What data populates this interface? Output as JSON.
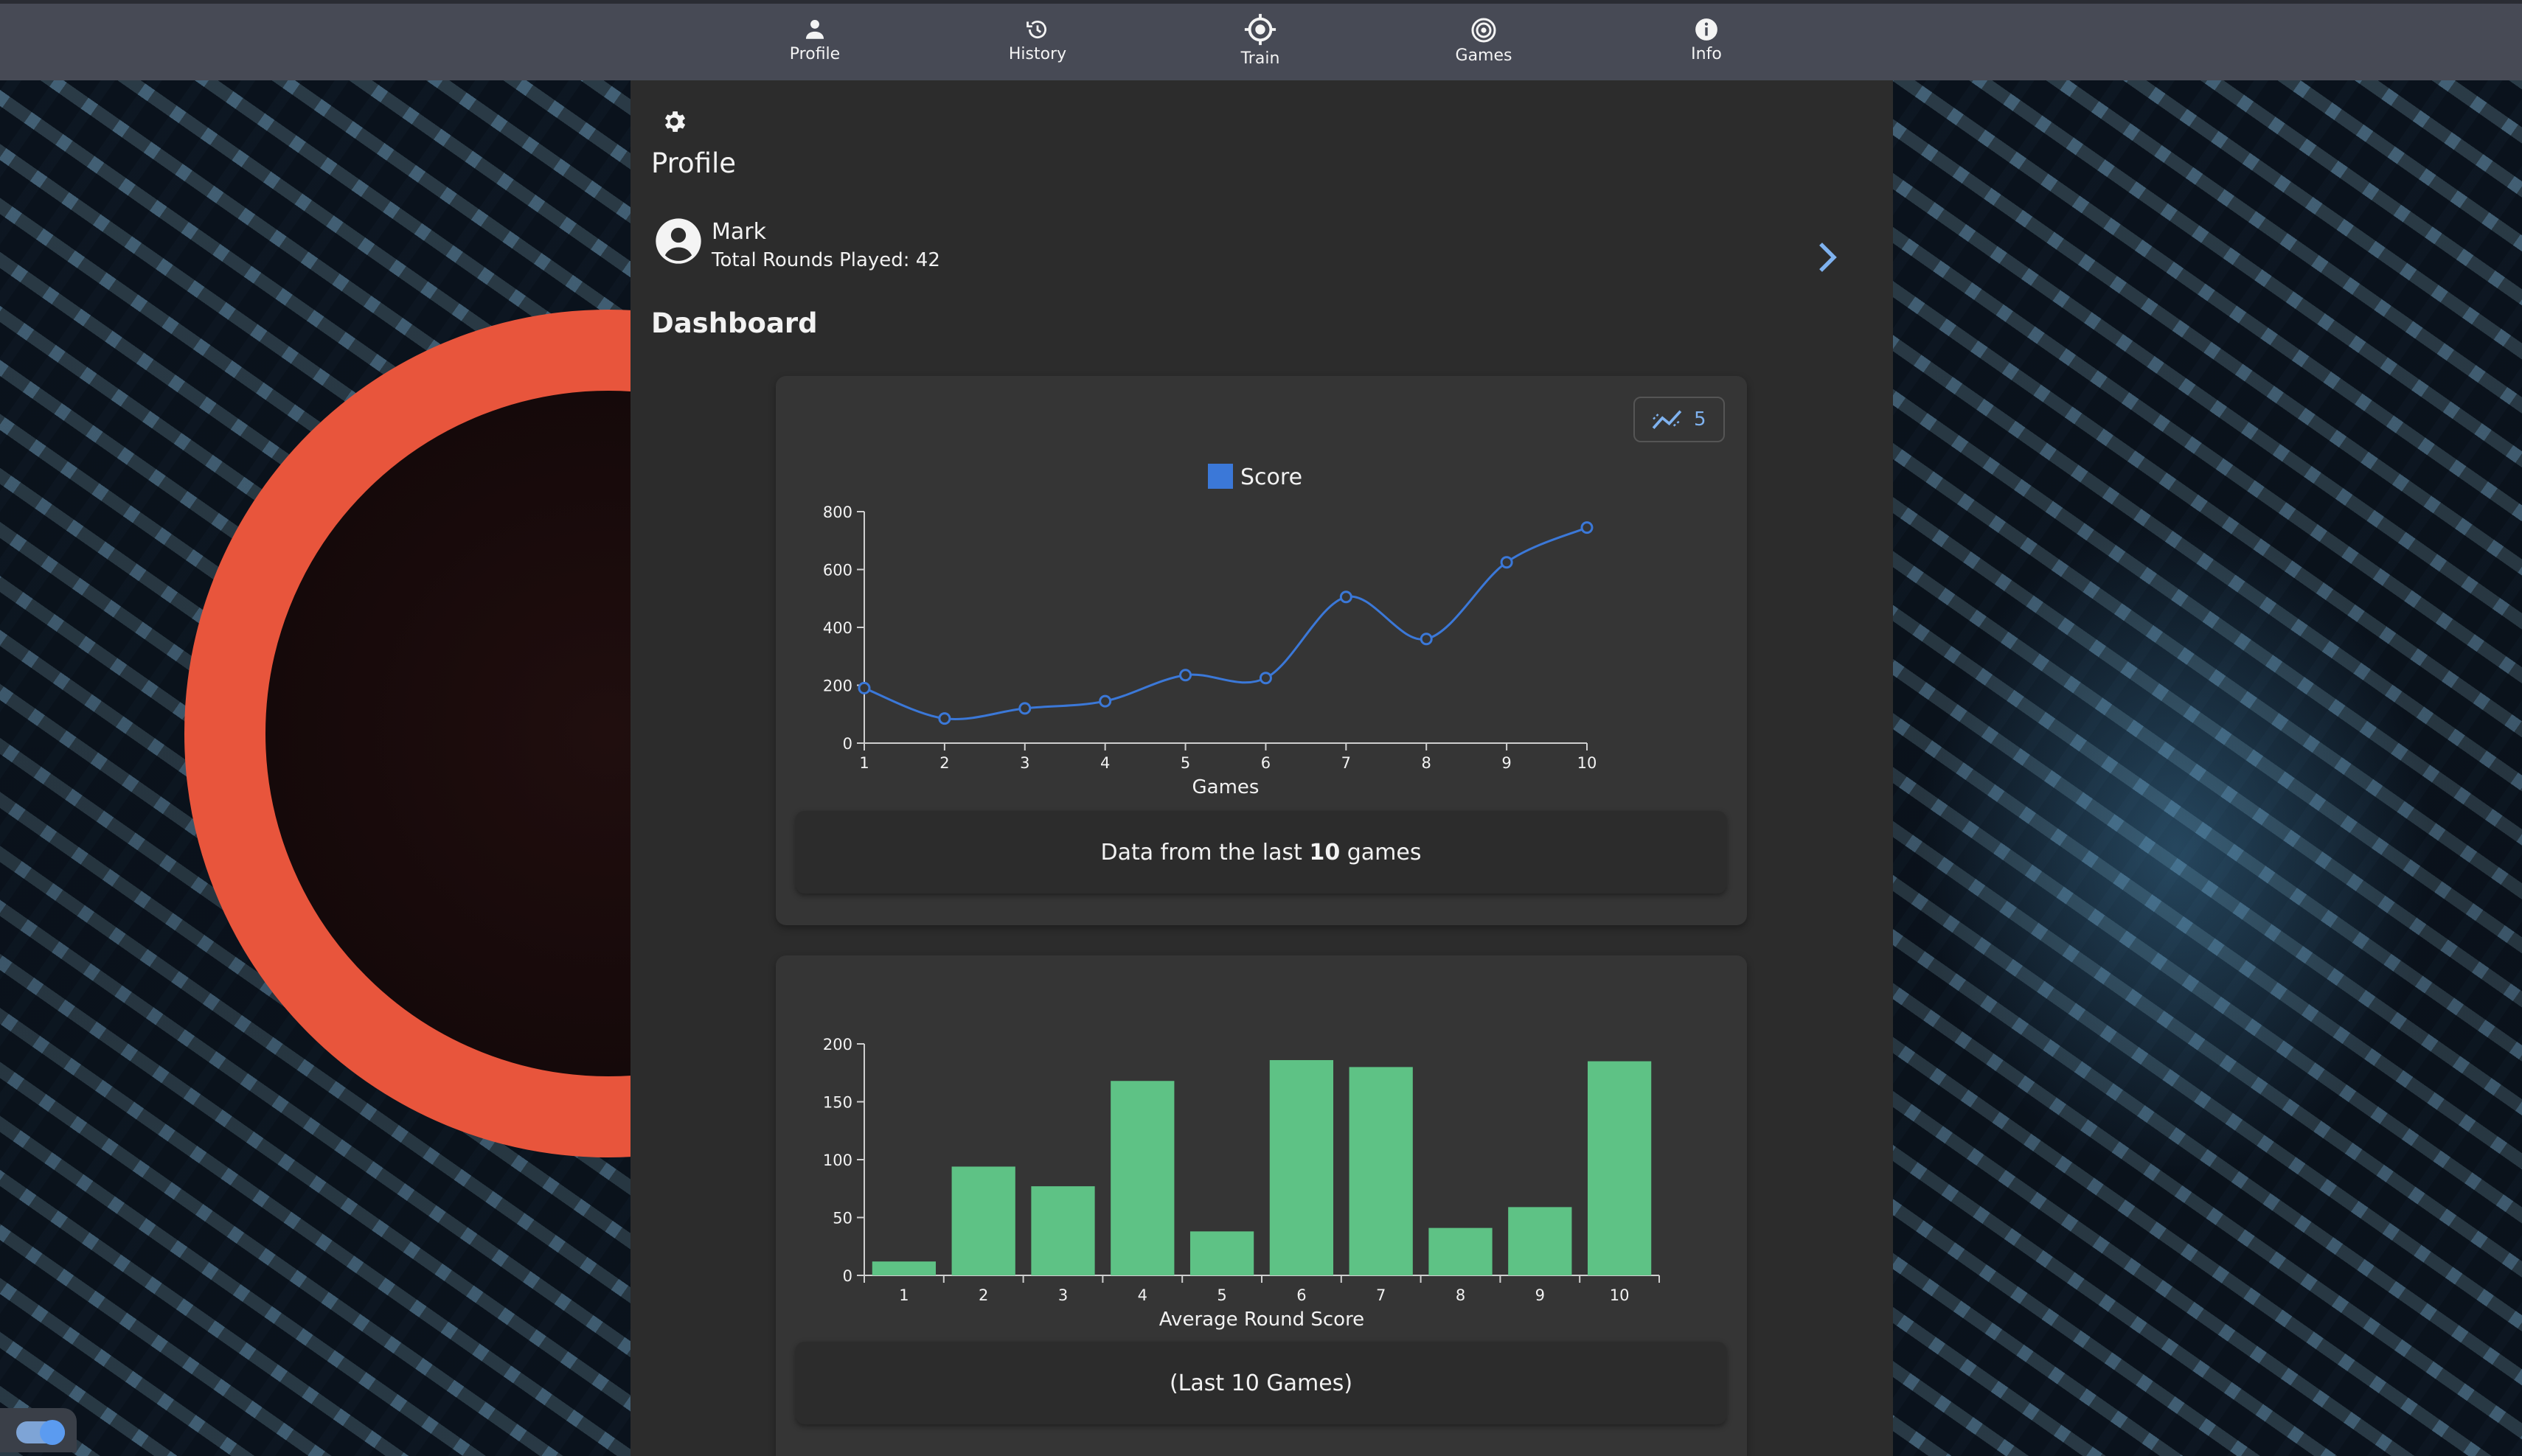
{
  "nav": {
    "items": [
      {
        "label": "Profile",
        "icon": "person-icon"
      },
      {
        "label": "History",
        "icon": "history-icon"
      },
      {
        "label": "Train",
        "icon": "crosshair-icon"
      },
      {
        "label": "Games",
        "icon": "target-icon"
      },
      {
        "label": "Info",
        "icon": "info-icon"
      }
    ]
  },
  "page": {
    "title": "Profile",
    "dashboard_title": "Dashboard"
  },
  "profile": {
    "name": "Mark",
    "rounds_text": "Total Rounds Played: 42"
  },
  "trend_button": {
    "value": "5"
  },
  "captions": {
    "score_prefix": "Data from the last ",
    "score_count": "10",
    "score_suffix": " games",
    "avg": "(Last 10 Games)"
  },
  "colors": {
    "accent": "#3b78d8",
    "bar": "#5ec285",
    "highlight": "#e8553c"
  },
  "chart_data": [
    {
      "type": "line",
      "legend": [
        "Score"
      ],
      "legend_placement": "top-center",
      "xlabel": "Games",
      "ylabel": "",
      "x": [
        1,
        2,
        3,
        4,
        5,
        6,
        7,
        8,
        9,
        10
      ],
      "xticks": [
        "1",
        "2",
        "3",
        "4",
        "5",
        "6",
        "7",
        "8",
        "9",
        "10"
      ],
      "yticks": [
        "0",
        "200",
        "400",
        "600",
        "800"
      ],
      "ylim": [
        0,
        800
      ],
      "series": [
        {
          "name": "Score",
          "values": [
            190,
            85,
            120,
            145,
            235,
            225,
            505,
            360,
            625,
            745
          ]
        }
      ],
      "grid": false
    },
    {
      "type": "bar",
      "categories": [
        "1",
        "2",
        "3",
        "4",
        "5",
        "6",
        "7",
        "8",
        "9",
        "10"
      ],
      "values": [
        12,
        94,
        77,
        168,
        38,
        186,
        180,
        41,
        59,
        185
      ],
      "xlabel": "Average Round Score",
      "ylabel": "",
      "yticks": [
        "0",
        "50",
        "100",
        "150",
        "200"
      ],
      "ylim": [
        0,
        200
      ],
      "grid": false
    }
  ]
}
